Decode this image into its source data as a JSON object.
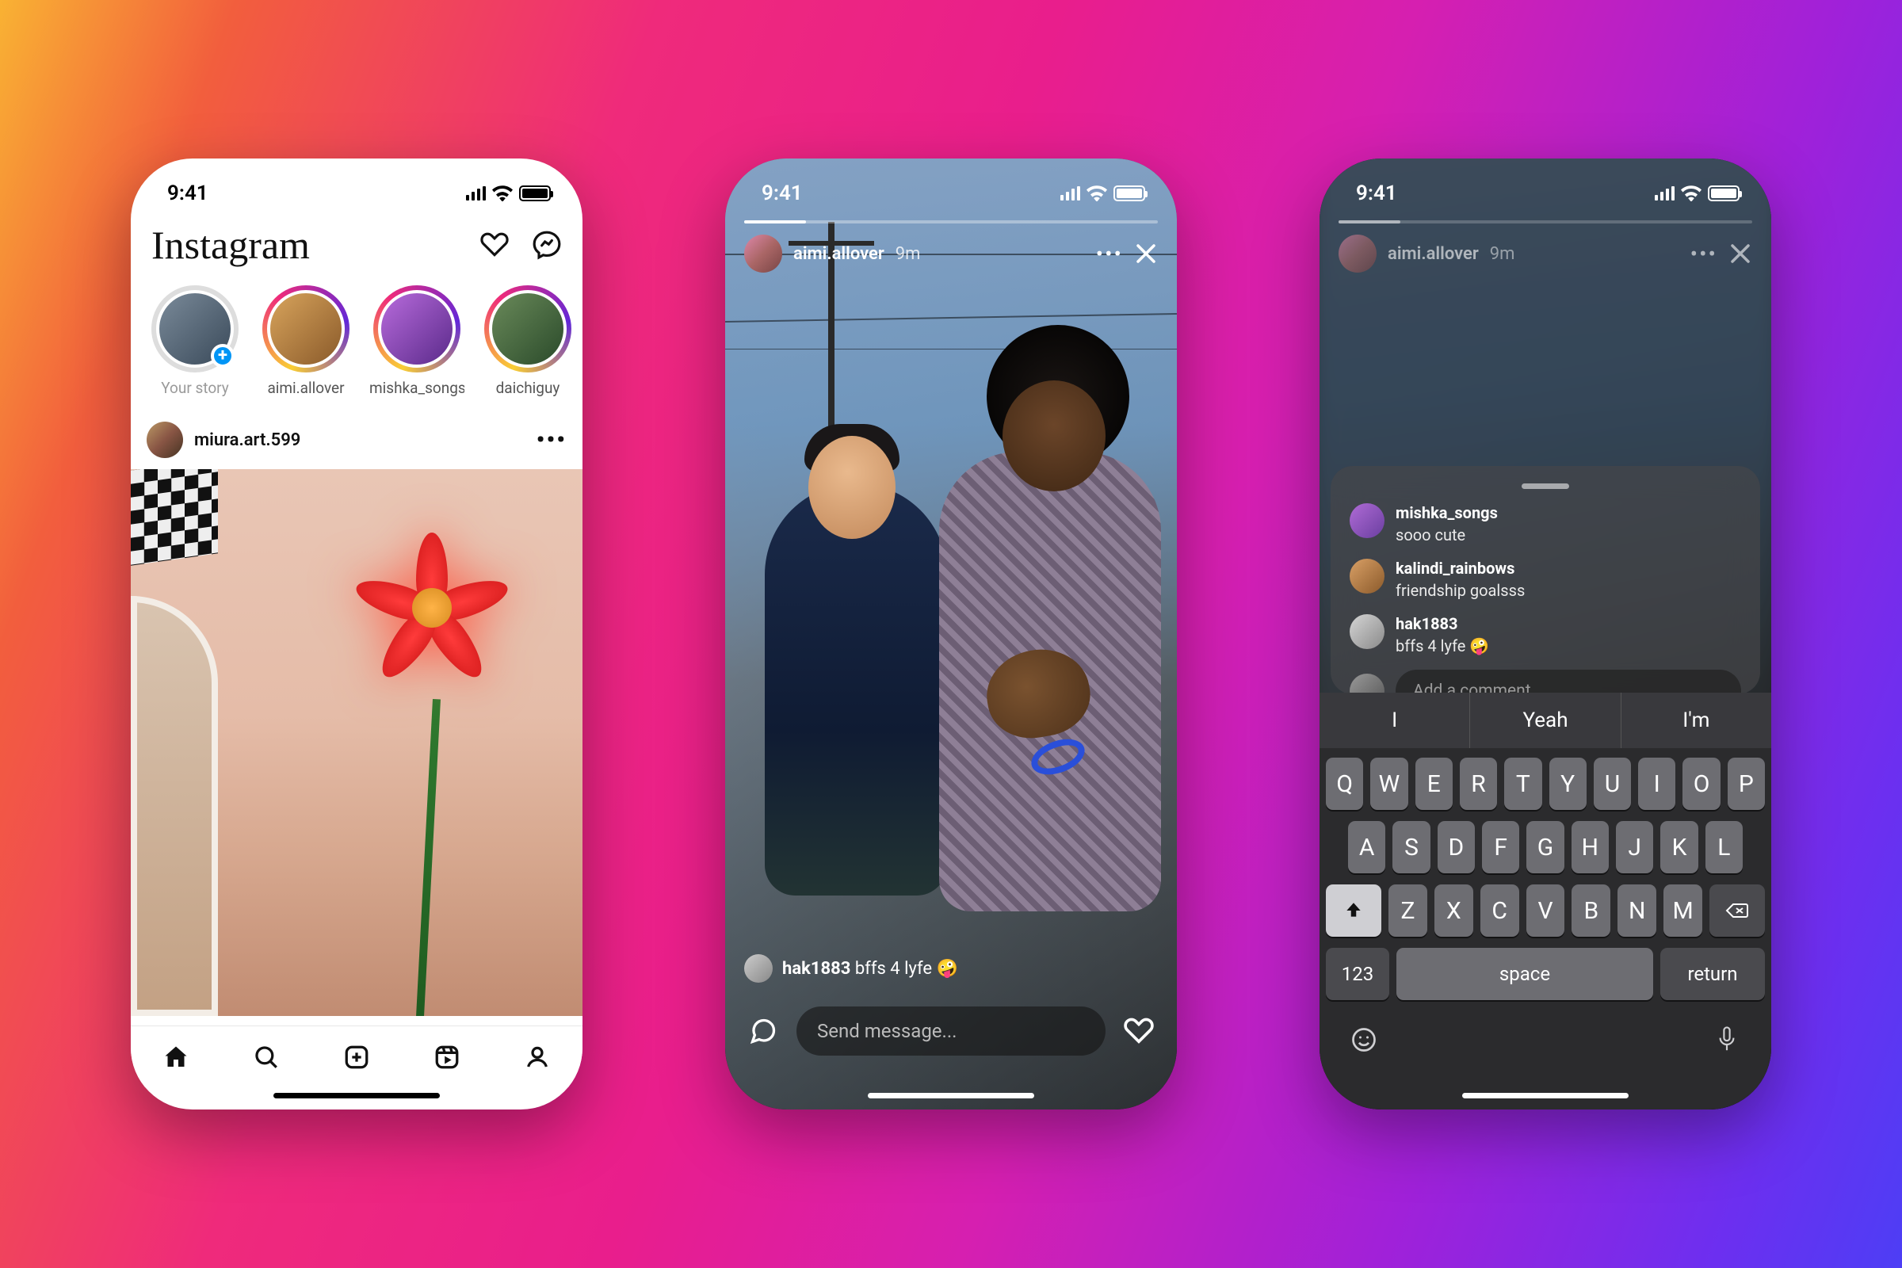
{
  "status": {
    "time": "9:41"
  },
  "feed": {
    "brand": "Instagram",
    "stories": [
      {
        "label": "Your story",
        "your": true
      },
      {
        "label": "aimi.allover"
      },
      {
        "label": "mishka_songs"
      },
      {
        "label": "daichiguy"
      }
    ],
    "post": {
      "username": "miura.art.599"
    }
  },
  "story": {
    "username": "aimi.allover",
    "time": "9m",
    "recent_comment": {
      "user": "hak1883",
      "text": "bffs 4 lyfe 🤪"
    },
    "message_placeholder": "Send message..."
  },
  "comments": {
    "items": [
      {
        "user": "mishka_songs",
        "text": "sooo cute",
        "color": "linear-gradient(135deg,#b06bd6,#6a3fa0)"
      },
      {
        "user": "kalindi_rainbows",
        "text": "friendship goalsss",
        "color": "linear-gradient(135deg,#d9a066,#8b5a2b)"
      },
      {
        "user": "hak1883",
        "text": "bffs 4 lyfe 🤪",
        "color": "linear-gradient(135deg,#d5d5d5,#8a8a8a)"
      }
    ],
    "input_placeholder": "Add a comment..."
  },
  "keyboard": {
    "predictions": [
      "I",
      "Yeah",
      "I'm"
    ],
    "row1": [
      "Q",
      "W",
      "E",
      "R",
      "T",
      "Y",
      "U",
      "I",
      "O",
      "P"
    ],
    "row2": [
      "A",
      "S",
      "D",
      "F",
      "G",
      "H",
      "J",
      "K",
      "L"
    ],
    "row3": [
      "Z",
      "X",
      "C",
      "V",
      "B",
      "N",
      "M"
    ],
    "numKey": "123",
    "spaceKey": "space",
    "returnKey": "return"
  }
}
